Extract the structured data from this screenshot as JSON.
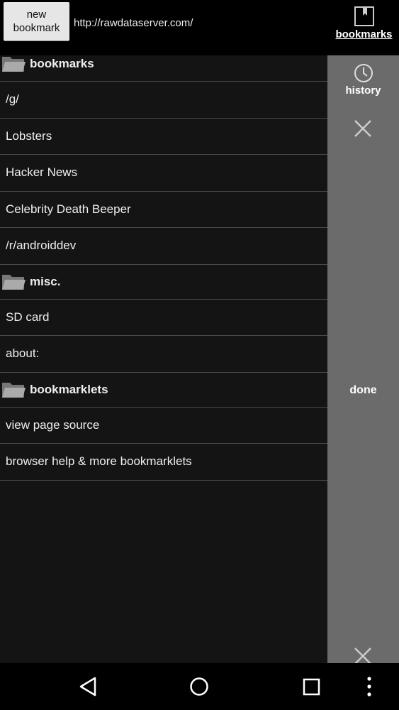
{
  "topbar": {
    "new_bookmark_label": "new\nbookmark",
    "url": "http://rawdataserver.com/",
    "bookmarks_tab_label": "bookmarks",
    "bookmarks_icon": "bookmark-icon"
  },
  "list": {
    "rows": [
      {
        "type": "folder",
        "label": "bookmarks"
      },
      {
        "type": "item",
        "label": "/g/"
      },
      {
        "type": "item",
        "label": "Lobsters"
      },
      {
        "type": "item",
        "label": "Hacker News"
      },
      {
        "type": "item",
        "label": "Celebrity Death Beeper"
      },
      {
        "type": "item",
        "label": "/r/androiddev"
      },
      {
        "type": "folder",
        "label": "misc."
      },
      {
        "type": "item",
        "label": "SD card"
      },
      {
        "type": "item",
        "label": "about:"
      },
      {
        "type": "folder",
        "label": "bookmarklets"
      },
      {
        "type": "item",
        "label": "view page source"
      },
      {
        "type": "item",
        "label": "browser help & more bookmarklets"
      }
    ]
  },
  "side": {
    "history_label": "history",
    "history_icon": "clock-icon",
    "close_icon": "close-icon",
    "done_label": "done"
  },
  "navbar": {
    "icons": [
      "back-icon",
      "home-icon",
      "recents-icon",
      "overflow-menu-icon"
    ]
  },
  "colors": {
    "background": "#141414",
    "side_panel": "#6b6b6b",
    "button": "#e6e6e6",
    "divider": "#4a4a4a"
  }
}
